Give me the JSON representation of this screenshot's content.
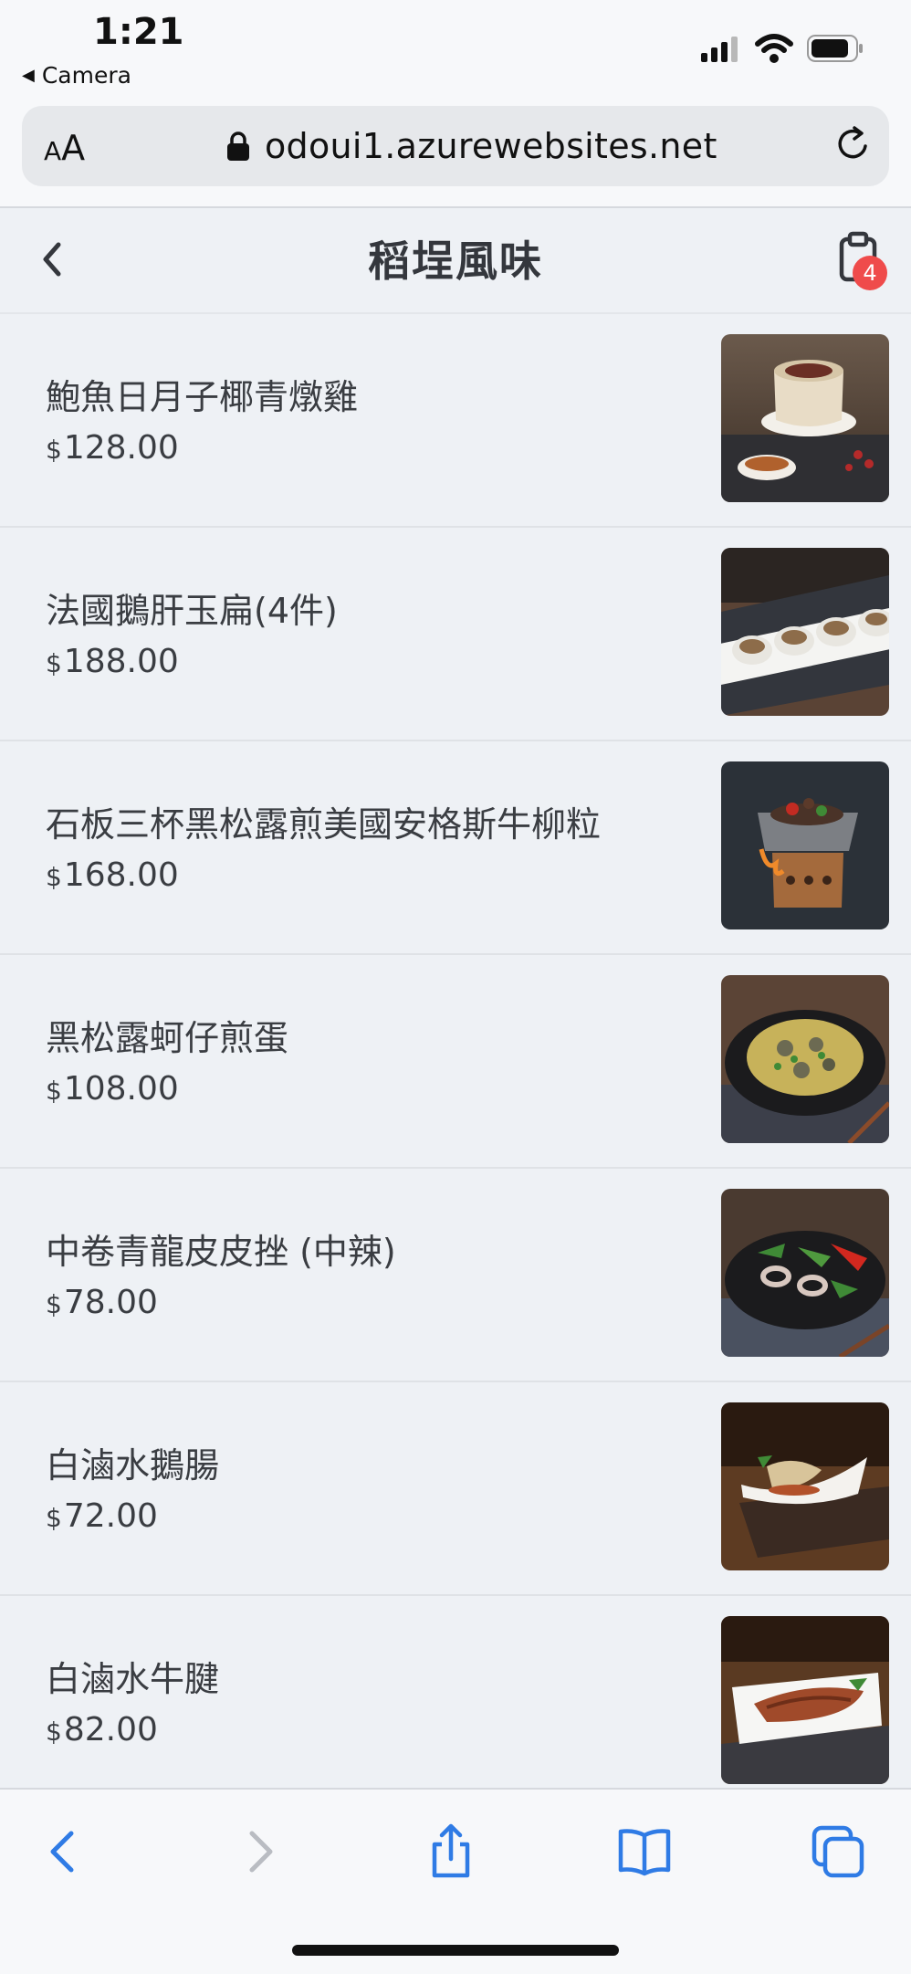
{
  "status_bar": {
    "time": "1:21",
    "back_app": "Camera"
  },
  "browser": {
    "text_size_label": "AA",
    "url": "odoui1.azurewebsites.net"
  },
  "app": {
    "title": "稻埕風味",
    "cart_count": "4",
    "currency_symbol": "$"
  },
  "menu_items": [
    {
      "name": "鮑魚日月子椰青燉雞",
      "price": "128.00",
      "image": "coconut-chicken-soup"
    },
    {
      "name": "法國鵝肝玉扁(4件)",
      "price": "188.00",
      "image": "foie-gras-bites"
    },
    {
      "name": "石板三杯黑松露煎美國安格斯牛柳粒",
      "price": "168.00",
      "image": "stone-plate-beef"
    },
    {
      "name": "黑松露蚵仔煎蛋",
      "price": "108.00",
      "image": "oyster-omelette"
    },
    {
      "name": "中卷青龍皮皮挫 (中辣)",
      "price": "78.00",
      "image": "squid-stir-fry"
    },
    {
      "name": "白滷水鵝腸",
      "price": "72.00",
      "image": "braised-goose-intestine"
    },
    {
      "name": "白滷水牛腱",
      "price": "82.00",
      "image": "braised-beef-shank"
    }
  ],
  "colors": {
    "accent": "#2f7be5",
    "badge": "#ef4b4b",
    "background": "#eef1f5"
  }
}
